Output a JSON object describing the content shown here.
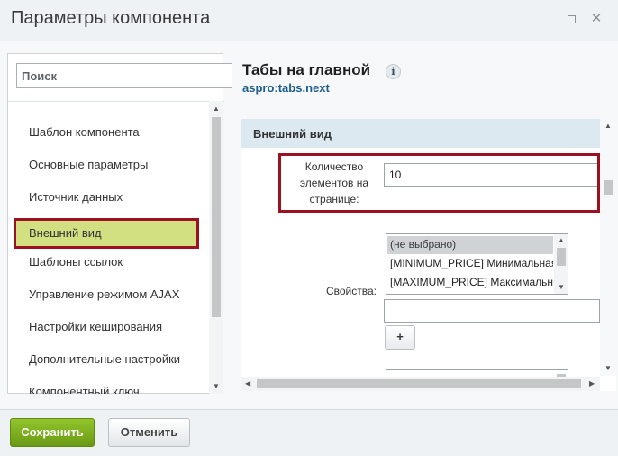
{
  "window": {
    "title": "Параметры компонента",
    "maximize_icon": "maximize-icon",
    "close_icon": "close-icon",
    "close_glyph": "✕"
  },
  "sidebar": {
    "search_placeholder": "Поиск",
    "items": [
      {
        "label": "Шаблон компонента"
      },
      {
        "label": "Основные параметры"
      },
      {
        "label": "Источник данных"
      },
      {
        "label": "Внешний вид",
        "active": true
      },
      {
        "label": "Шаблоны ссылок"
      },
      {
        "label": "Управление режимом AJAX"
      },
      {
        "label": "Настройки кеширования"
      },
      {
        "label": "Дополнительные настройки"
      },
      {
        "label": "Компонентный ключ"
      }
    ]
  },
  "component": {
    "title": "Табы на главной",
    "info_glyph": "i",
    "code": "aspro:tabs.next"
  },
  "section": {
    "title": "Внешний вид",
    "count_label": "Количество элементов на странице:",
    "count_value": "10",
    "props_label": "Свойства:",
    "props_options": [
      {
        "label": "(не выбрано)",
        "selected": true
      },
      {
        "label": "[MINIMUM_PRICE] Минимальная цена"
      },
      {
        "label": "[MAXIMUM_PRICE] Максимальная цена"
      }
    ],
    "extra_value": "",
    "add_button": "+"
  },
  "footer": {
    "save_label": "Сохранить",
    "cancel_label": "Отменить"
  },
  "colors": {
    "accent_green": "#7bae1c",
    "highlight_frame": "#9b1121",
    "active_item_bg": "#d2e082",
    "link_blue": "#1b5c92"
  }
}
